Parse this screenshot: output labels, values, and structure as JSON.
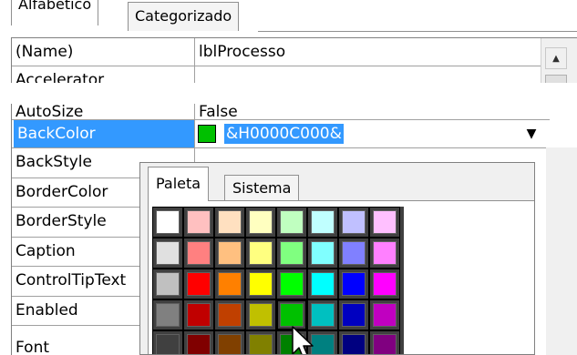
{
  "tabs": [
    "Alfabético",
    "Categorizado"
  ],
  "properties_top": [
    {
      "name": "(Name)",
      "value": "lblProcesso"
    },
    {
      "name": "Accelerator",
      "value": ""
    }
  ],
  "properties_bottom": [
    {
      "name": "AutoSize",
      "value": "False"
    },
    {
      "name": "BackColor",
      "value": "&H0000C000&",
      "selected": true,
      "swatch_color": "#00c000"
    },
    {
      "name": "BackStyle",
      "value": ""
    },
    {
      "name": "BorderColor",
      "value": ""
    },
    {
      "name": "BorderStyle",
      "value": ""
    },
    {
      "name": "Caption",
      "value": ""
    },
    {
      "name": "ControlTipText",
      "value": ""
    },
    {
      "name": "Enabled",
      "value": ""
    },
    {
      "name": "Font",
      "value": ""
    }
  ],
  "palette": {
    "tabs": [
      "Paleta",
      "Sistema"
    ],
    "active_tab": "Paleta",
    "selected_color": "#00c000",
    "colors": [
      [
        "#ffffff",
        "#ffc0c0",
        "#ffe0c0",
        "#ffffc0",
        "#c0ffc0",
        "#c0ffff",
        "#c0c0ff",
        "#ffc0ff"
      ],
      [
        "#e0e0e0",
        "#ff8080",
        "#ffc080",
        "#ffff80",
        "#80ff80",
        "#80ffff",
        "#8080ff",
        "#ff80ff"
      ],
      [
        "#c0c0c0",
        "#ff0000",
        "#ff8000",
        "#ffff00",
        "#00ff00",
        "#00ffff",
        "#0000ff",
        "#ff00ff"
      ],
      [
        "#808080",
        "#c00000",
        "#c04000",
        "#c0c000",
        "#00c000",
        "#00c0c0",
        "#0000c0",
        "#c000c0"
      ],
      [
        "#404040",
        "#800000",
        "#804000",
        "#808000",
        "#008000",
        "#008080",
        "#000080",
        "#800080"
      ]
    ]
  },
  "colors": {
    "selection": "#3399ff",
    "grid_line": "#a0a0a0",
    "border": "#808080"
  },
  "icons": {
    "scroll_up": "▲",
    "dropdown": "▼"
  }
}
